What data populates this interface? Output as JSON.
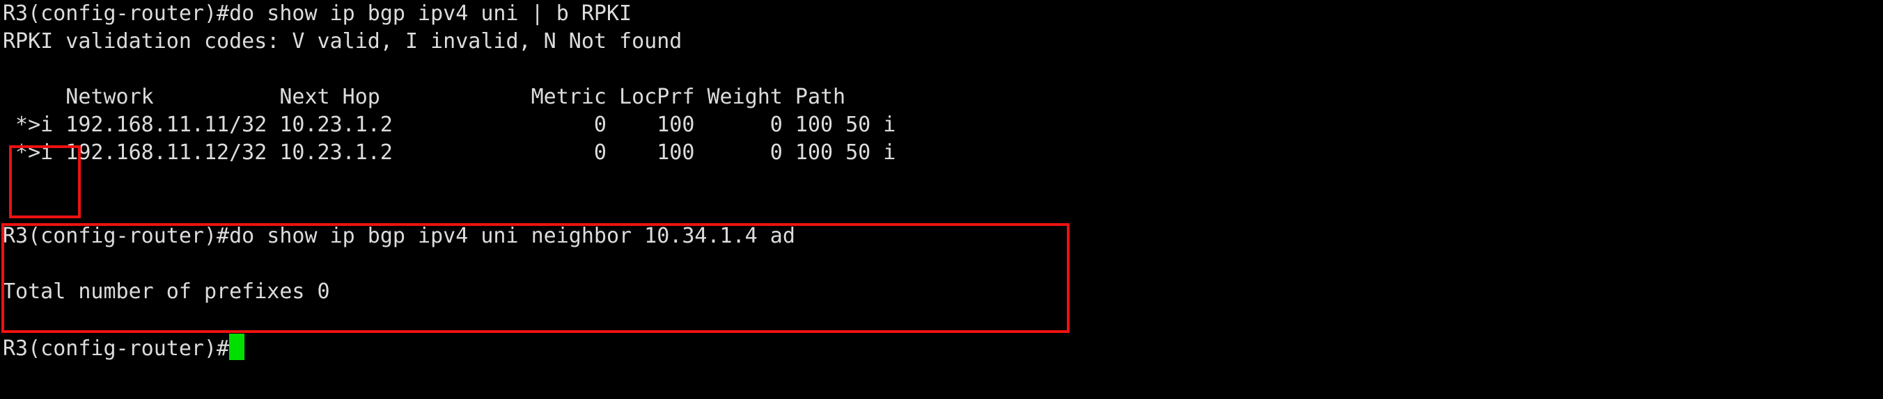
{
  "terminal": {
    "background_color": "#000000",
    "text_color": "#dcdcdc",
    "cursor_color": "#00e000",
    "annotation_color": "#ee1111",
    "lines": [
      "R3(config-router)#do show ip bgp ipv4 uni | b RPKI",
      "RPKI validation codes: V valid, I invalid, N Not found",
      "",
      "     Network          Next Hop            Metric LocPrf Weight Path",
      " *>i 192.168.11.11/32 10.23.1.2                0    100      0 100 50 i",
      " *>i 192.168.11.12/32 10.23.1.2                0    100      0 100 50 i",
      "R3(config-router)#do show ip bgp ipv4 uni neighbor 10.34.1.4 ad",
      "",
      "Total number of prefixes 0",
      "R3(config-router)#"
    ],
    "prompt": "R3(config-router)#",
    "commands": [
      "do show ip bgp ipv4 uni | b RPKI",
      "do show ip bgp ipv4 uni neighbor 10.34.1.4 ad"
    ],
    "rpki_legend": "RPKI validation codes: V valid, I invalid, N Not found",
    "bgp_table": {
      "headers": [
        "Network",
        "Next Hop",
        "Metric",
        "LocPrf",
        "Weight",
        "Path"
      ],
      "rows": [
        {
          "status": "*>i",
          "network": "192.168.11.11/32",
          "next_hop": "10.23.1.2",
          "metric": "0",
          "locprf": "100",
          "weight": "0",
          "path": "100 50 i"
        },
        {
          "status": "*>i",
          "network": "192.168.11.12/32",
          "next_hop": "10.23.1.2",
          "metric": "0",
          "locprf": "100",
          "weight": "0",
          "path": "100 50 i"
        }
      ]
    },
    "total_prefixes_line": "Total number of prefixes 0",
    "annotations": [
      {
        "name": "status-flags-highlight",
        "label": ""
      },
      {
        "name": "neighbor-advertised-highlight",
        "label": ""
      }
    ]
  }
}
